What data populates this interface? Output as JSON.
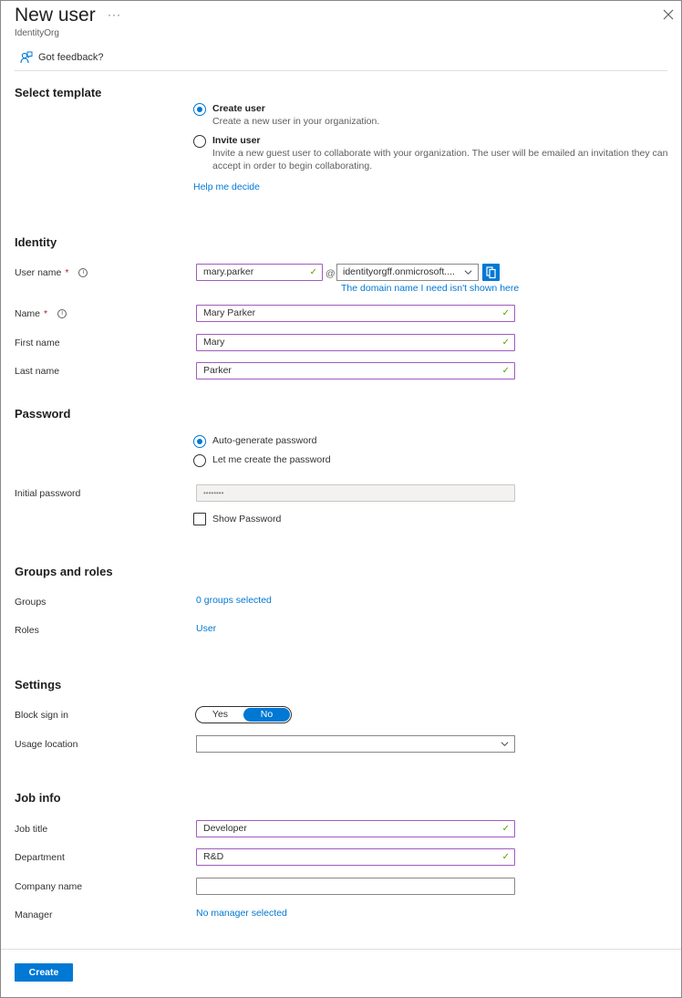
{
  "header": {
    "title": "New user",
    "more_label": "···",
    "subtitle": "IdentityOrg",
    "feedback_label": "Got feedback?"
  },
  "template": {
    "heading": "Select template",
    "options": [
      {
        "title": "Create user",
        "description": "Create a new user in your organization.",
        "selected": true
      },
      {
        "title": "Invite user",
        "description_line1": "Invite a new guest user to collaborate with your organization. The user will be emailed an invitation they can",
        "description_line2": "accept in order to begin collaborating.",
        "selected": false
      }
    ],
    "help_link": "Help me decide"
  },
  "identity": {
    "heading": "Identity",
    "user_name_label": "User name",
    "user_name_value": "mary.parker",
    "at_symbol": "@",
    "domain_value": "identityorgff.onmicrosoft....",
    "domain_link": "The domain name I need isn't shown here",
    "name_label": "Name",
    "name_value": "Mary Parker",
    "first_name_label": "First name",
    "first_name_value": "Mary",
    "last_name_label": "Last name",
    "last_name_value": "Parker",
    "required_mark": "*",
    "info_glyph": "i",
    "check_glyph": "✓"
  },
  "password": {
    "heading": "Password",
    "options": [
      {
        "label": "Auto-generate password",
        "selected": true
      },
      {
        "label": "Let me create the password",
        "selected": false
      }
    ],
    "initial_label": "Initial password",
    "initial_value": "••••••••",
    "show_password_label": "Show Password",
    "show_password_checked": false
  },
  "groups_roles": {
    "heading": "Groups and roles",
    "groups_label": "Groups",
    "groups_value": "0 groups selected",
    "roles_label": "Roles",
    "roles_value": "User"
  },
  "settings": {
    "heading": "Settings",
    "block_sign_in_label": "Block sign in",
    "toggle_yes": "Yes",
    "toggle_no": "No",
    "toggle_selected": "No",
    "usage_location_label": "Usage location",
    "usage_location_value": ""
  },
  "job_info": {
    "heading": "Job info",
    "job_title_label": "Job title",
    "job_title_value": "Developer",
    "department_label": "Department",
    "department_value": "R&D",
    "company_label": "Company name",
    "company_value": "",
    "manager_label": "Manager",
    "manager_value": "No manager selected"
  },
  "footer": {
    "create_label": "Create"
  },
  "colors": {
    "accent": "#0078d4",
    "valid_border": "#a05bbf",
    "valid_check": "#57a300",
    "required": "#a4262c"
  }
}
